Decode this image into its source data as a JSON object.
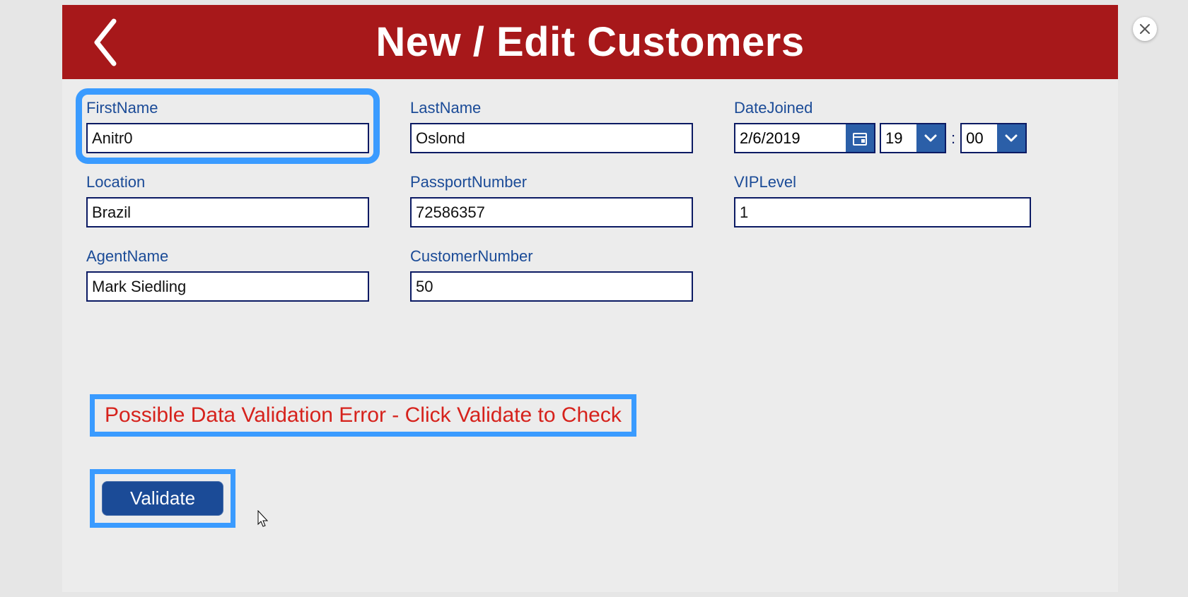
{
  "header": {
    "title": "New / Edit Customers"
  },
  "form": {
    "firstName": {
      "label": "FirstName",
      "value": "Anitr0"
    },
    "lastName": {
      "label": "LastName",
      "value": "Oslond"
    },
    "dateJoined": {
      "label": "DateJoined",
      "date": "2/6/2019",
      "hour": "19",
      "minute": "00"
    },
    "location": {
      "label": "Location",
      "value": "Brazil"
    },
    "passportNumber": {
      "label": "PassportNumber",
      "value": "72586357"
    },
    "vipLevel": {
      "label": "VIPLevel",
      "value": "1"
    },
    "agentName": {
      "label": "AgentName",
      "value": "Mark Siedling"
    },
    "customerNumber": {
      "label": "CustomerNumber",
      "value": "50"
    }
  },
  "validation": {
    "message": "Possible Data Validation Error - Click Validate to Check"
  },
  "buttons": {
    "validate": "Validate"
  },
  "colors": {
    "headerBg": "#a7181a",
    "labelColor": "#1b4b97",
    "inputBorder": "#0b1a63",
    "accentBlue": "#2b5fa8",
    "highlight": "#3a9bff",
    "errorText": "#d6221c"
  }
}
